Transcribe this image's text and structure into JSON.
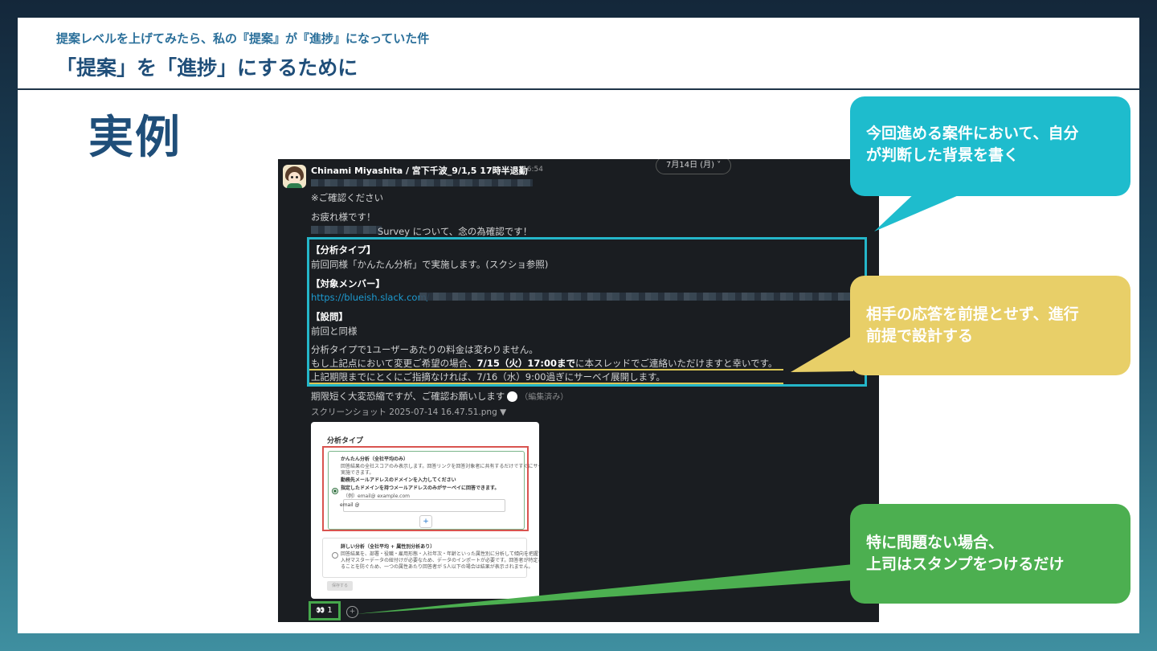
{
  "slide": {
    "subtitle": "提案レベルを上げてみたら、私の『提案』が『進捗』になっていた件",
    "title": "「提案」を「進捗」にするために",
    "heading": "実例"
  },
  "slack": {
    "sender": "Chinami Miyashita / 宮下千波_9/1,5 17時半退勤",
    "time": "16:54",
    "date_pill": "7月14日 (月) ˅",
    "lines": {
      "confirm": "※ご確認ください",
      "greeting": "お疲れ様です！",
      "survey": "Survey について、念の為確認です！",
      "h_type": "【分析タイプ】",
      "type_body": "前回同様「かんたん分析」で実施します。(スクショ参照)",
      "h_members": "【対象メンバー】",
      "link": "https://blueish.slack.com/",
      "h_question": "【設問】",
      "question_body": "前回と同様",
      "price": "分析タイプで1ユーザーあたりの料金は変わりません。",
      "change_pre": "もし上記点において変更ご希望の場合、",
      "change_bold": "7/15（火）17:00まで",
      "change_post": "に本スレッドでご連絡いただけますと幸いです。",
      "deadline": "上記期限までにとくにご指摘なければ、7/16（水）9:00過ぎにサーベイ展開します。",
      "closing": "期限短く大変恐縮ですが、ご確認お願いします",
      "edited": "（編集済み）",
      "attachment": "スクリーンショット 2025-07-14 16.47.51.png ▼"
    },
    "preview": {
      "title": "分析タイプ",
      "opt1_title": "かんたん分析（全社平均のみ）",
      "opt1_desc": "回答結果の全社スコアのみ表示します。回答リンクを回答対象者に共有するだけですぐにサーベイを",
      "opt1_desc2": "実施できます。",
      "domain_label": "勤務先メールアドレスのドメインを入力してください",
      "domain_desc": "指定したドメインを持つメールアドレスのみがサーベイに回答できます。",
      "example": "（例）email@ example.com",
      "email_label": "email @",
      "plus": "+",
      "opt2_title": "詳しい分析（全社平均 + 属性別分析あり）",
      "opt2_desc": "回答結果を、部署・役職・雇用形態・入社年次・年齢といった属性別に分析して傾向を把握できます。",
      "opt2_desc2": "入材マスターデータの紐付けが必要なため、データのインポートが必要です。回答者が特定され",
      "opt2_desc3": "ることを防ぐため、一つの属性あたり回答者が 5人以下の場合は結果が表示されません。",
      "save_btn": "保存する"
    },
    "reaction_count": "1",
    "reaction_emoji": "👀",
    "add_reaction": "+"
  },
  "callouts": {
    "c1_line1": "今回進める案件において、自分",
    "c1_line2": "が判断した背景を書く",
    "c2_line1": "相手の応答を前提とせず、進行",
    "c2_line2": "前提で設計する",
    "c3_line1": "特に問題ない場合、",
    "c3_line2": "上司はスタンプをつけるだけ"
  },
  "colors": {
    "cyan": "#1ebccd",
    "yellow": "#e8cf68",
    "green": "#4caf50",
    "navy": "#1f4e79"
  }
}
